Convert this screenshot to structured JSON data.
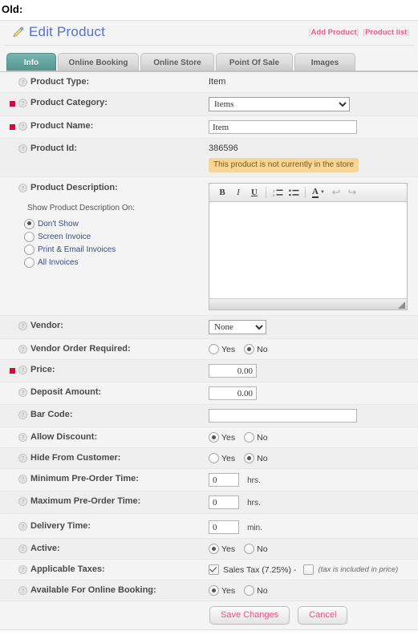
{
  "caption": "Old:",
  "header": {
    "title": "Edit Product",
    "icon": "pencil-edit-icon",
    "links": [
      {
        "label": "Add Product"
      },
      {
        "label": "Product list"
      }
    ],
    "bracket_open": "[",
    "bracket_close": "]"
  },
  "tabs": [
    {
      "label": "Info",
      "active": true
    },
    {
      "label": "Online Booking",
      "active": false
    },
    {
      "label": "Online Store",
      "active": false
    },
    {
      "label": "Point Of Sale",
      "active": false
    },
    {
      "label": "Images",
      "active": false
    }
  ],
  "form": {
    "product_type": {
      "label": "Product Type:",
      "value": "Item"
    },
    "product_category": {
      "label": "Product Category:",
      "selected": "Items",
      "options": [
        "Items"
      ]
    },
    "product_name": {
      "label": "Product Name:",
      "value": "Item",
      "placeholder": ""
    },
    "product_id": {
      "label": "Product Id:",
      "value": "386596",
      "notice": "This product is not currently in the store"
    },
    "product_description": {
      "label": "Product Description:",
      "sub_label": "Show Product Description On:",
      "options": [
        {
          "label": "Don't Show",
          "selected": true
        },
        {
          "label": "Screen Invoice",
          "selected": false
        },
        {
          "label": "Print & Email Invoices",
          "selected": false
        },
        {
          "label": "All Invoices",
          "selected": false
        }
      ],
      "editor": {
        "content": "",
        "toolbar": [
          {
            "name": "bold-button",
            "glyph": "B"
          },
          {
            "name": "italic-button",
            "glyph": "I"
          },
          {
            "name": "underline-button",
            "glyph": "U"
          },
          {
            "name": "ordered-list-button",
            "glyph": "ol"
          },
          {
            "name": "unordered-list-button",
            "glyph": "ul"
          },
          {
            "name": "font-color-button",
            "glyph": "A"
          },
          {
            "name": "undo-button",
            "glyph": "↩"
          },
          {
            "name": "redo-button",
            "glyph": "↪"
          }
        ]
      }
    },
    "vendor": {
      "label": "Vendor:",
      "selected": "None",
      "options": [
        "None"
      ]
    },
    "vendor_order_required": {
      "label": "Vendor Order Required:",
      "options": [
        {
          "label": "Yes",
          "selected": false
        },
        {
          "label": "No",
          "selected": true
        }
      ]
    },
    "price": {
      "label": "Price:",
      "value": "0.00"
    },
    "deposit_amount": {
      "label": "Deposit Amount:",
      "value": "0.00"
    },
    "bar_code": {
      "label": "Bar Code:",
      "value": ""
    },
    "allow_discount": {
      "label": "Allow Discount:",
      "options": [
        {
          "label": "Yes",
          "selected": true
        },
        {
          "label": "No",
          "selected": false
        }
      ]
    },
    "hide_from_customer": {
      "label": "Hide From Customer:",
      "options": [
        {
          "label": "Yes",
          "selected": false
        },
        {
          "label": "No",
          "selected": true
        }
      ]
    },
    "minimum_preorder_time": {
      "label": "Minimum Pre-Order Time:",
      "value": "0",
      "unit": "hrs."
    },
    "maximum_preorder_time": {
      "label": "Maximum Pre-Order Time:",
      "value": "0",
      "unit": "hrs."
    },
    "delivery_time": {
      "label": "Delivery Time:",
      "value": "0",
      "unit": "min."
    },
    "active": {
      "label": "Active:",
      "options": [
        {
          "label": "Yes",
          "selected": true
        },
        {
          "label": "No",
          "selected": false
        }
      ]
    },
    "applicable_taxes": {
      "label": "Applicable Taxes:",
      "tax_label": "Sales Tax (7.25%) -",
      "tax_checked": true,
      "included_label": "(tax is included in price)",
      "included_checked": false
    },
    "available_for_online_booking": {
      "label": "Available For Online Booking:",
      "options": [
        {
          "label": "Yes",
          "selected": true
        },
        {
          "label": "No",
          "selected": false
        }
      ]
    }
  },
  "footer": {
    "save_label": "Save Changes",
    "cancel_label": "Cancel"
  },
  "colors": {
    "accent_teal": "#62a39d",
    "link_pink": "#ef5a86",
    "title_blue": "#5271d0",
    "required_red": "#c8103f",
    "notice_bg": "#f7d596"
  }
}
